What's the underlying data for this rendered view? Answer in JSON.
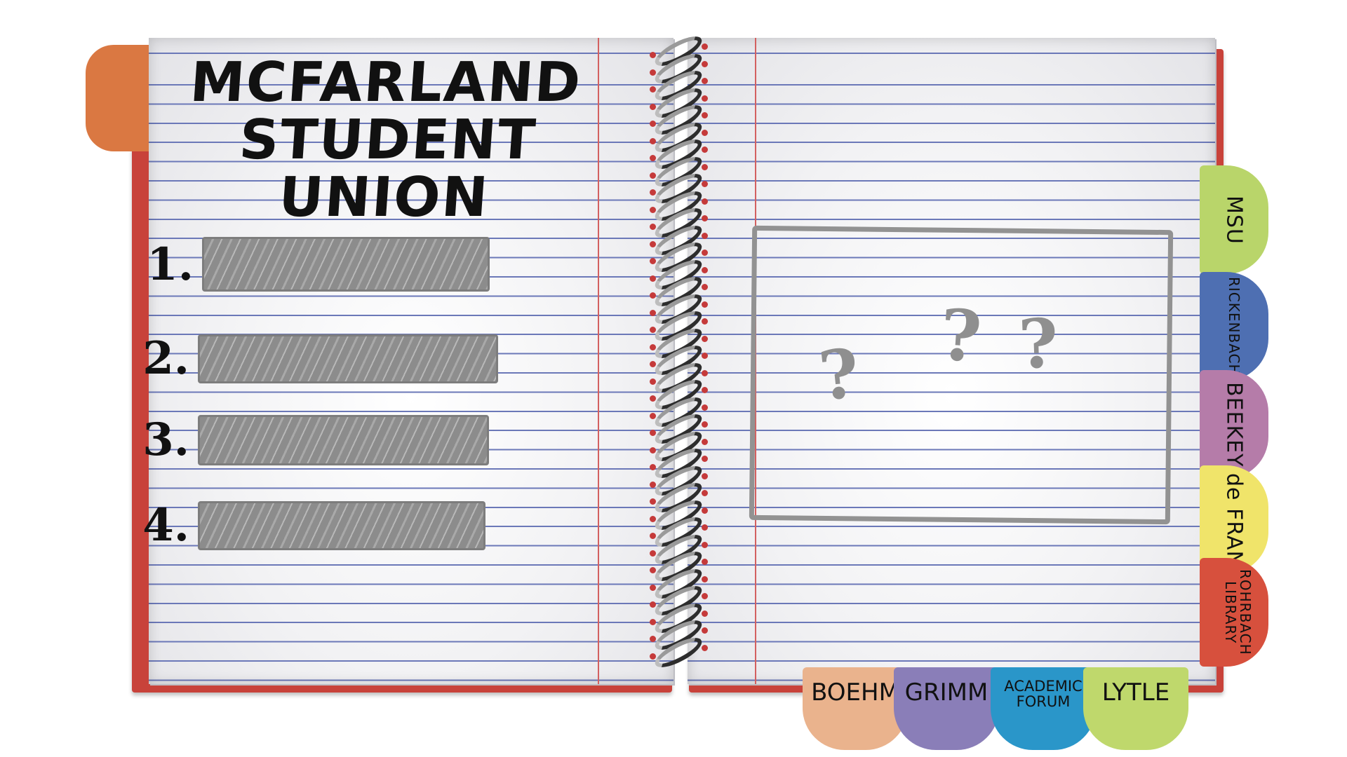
{
  "title": {
    "line1": "MCFARLAND",
    "line2": "STUDENT UNION"
  },
  "list": [
    {
      "number": "1."
    },
    {
      "number": "2."
    },
    {
      "number": "3."
    },
    {
      "number": "4."
    }
  ],
  "placeholder": {
    "marks": [
      "?",
      "?",
      "?"
    ]
  },
  "side_tabs": [
    {
      "label": "MSU",
      "color": "#b9d56a"
    },
    {
      "label": "RICKENBACH",
      "color": "#4e6fb2"
    },
    {
      "label": "BEEKEY",
      "color": "#b57ca9"
    },
    {
      "label": "de FRAN",
      "color": "#f0e46a"
    },
    {
      "label": "ROHRBACH LIBRARY",
      "color": "#d7503d"
    }
  ],
  "bottom_tabs": [
    {
      "label": "BOEHM",
      "color": "#eab38d"
    },
    {
      "label": "GRIMM",
      "color": "#8a7eb8"
    },
    {
      "label": "ACADEMIC FORUM",
      "color": "#2a96c9"
    },
    {
      "label": "LYTLE",
      "color": "#bfd86c"
    }
  ],
  "colors": {
    "cover": "#c8423a",
    "orange_tab": "#da7842",
    "sketch_gray": "#8f8f8f"
  }
}
